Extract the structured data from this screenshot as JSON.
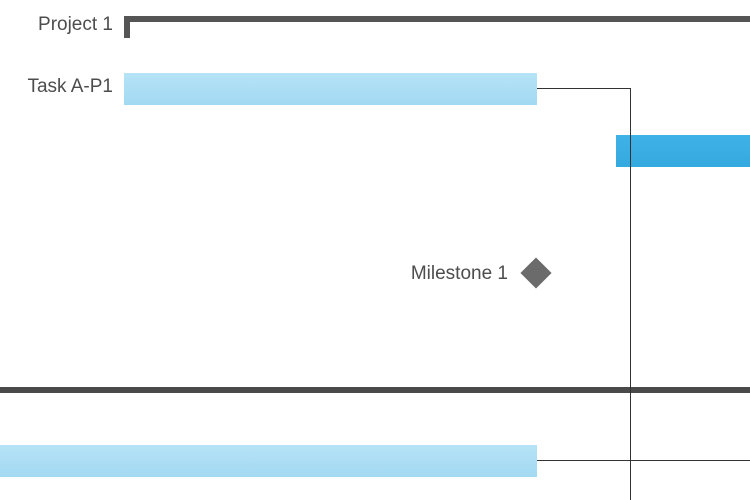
{
  "gantt": {
    "project": {
      "label": "Project 1"
    },
    "tasks": [
      {
        "label": "Task A-P1"
      }
    ],
    "milestone": {
      "label": "Milestone 1"
    }
  },
  "colors": {
    "task_bar_light": "#a8dcf3",
    "task_bar_selected": "#3aafe3",
    "summary_bar": "#555555",
    "milestone": "#6b6b6b",
    "connector": "#333333"
  }
}
